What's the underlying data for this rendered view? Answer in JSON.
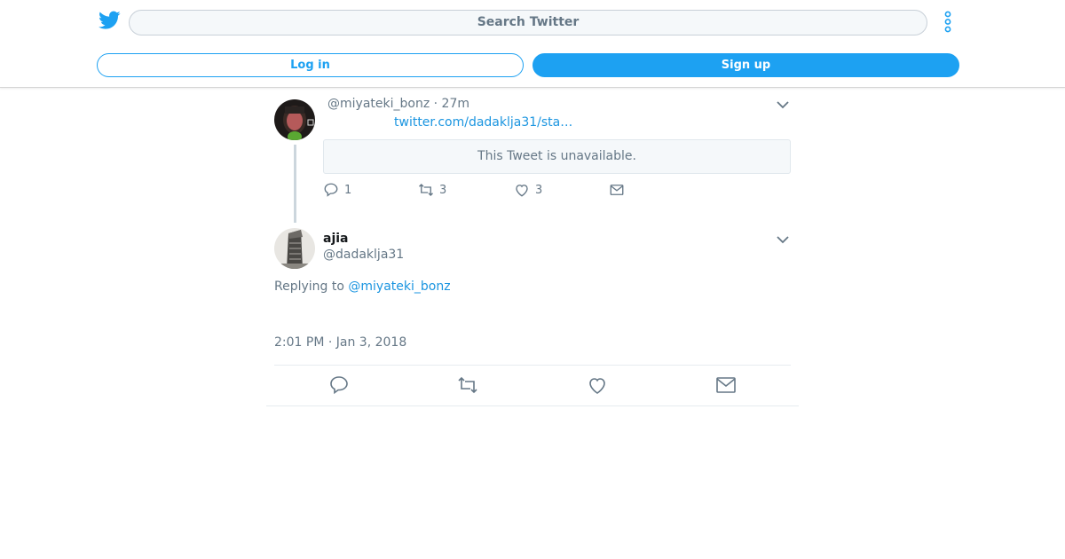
{
  "header": {
    "search_placeholder": "Search Twitter",
    "login_label": "Log in",
    "signup_label": "Sign up",
    "brand_color": "#1da1f2"
  },
  "parent_tweet": {
    "handle": "@miyateki_bonz",
    "separator": "·",
    "age": "27m",
    "link_text": "twitter.com/dadaklja31/sta…",
    "unavailable_text": "This Tweet is unavailable.",
    "replies": "1",
    "retweets": "3",
    "likes": "3"
  },
  "main_tweet": {
    "name": "ajia",
    "handle": "@dadaklja31",
    "replying_prefix": "Replying to ",
    "replying_to": "@miyateki_bonz",
    "timestamp": "2:01 PM · Jan 3, 2018"
  },
  "icons": [
    "twitter-bird-icon",
    "more-vertical-icon",
    "chevron-down-icon",
    "reply-icon",
    "retweet-icon",
    "heart-icon",
    "mail-icon"
  ]
}
